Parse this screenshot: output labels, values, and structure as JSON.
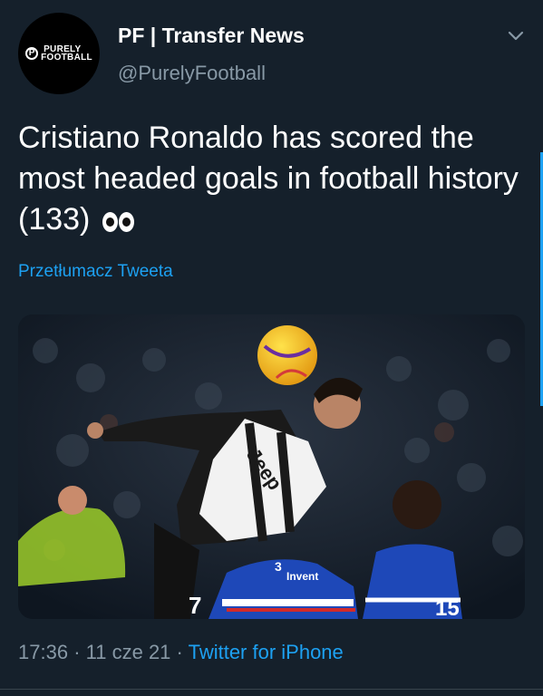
{
  "author": {
    "display_name": "PF | Transfer News",
    "handle": "@PurelyFootball",
    "avatar_logo_line1": "PURELY",
    "avatar_logo_line2": "FOOTBALL",
    "avatar_logo_mark": "P"
  },
  "tweet": {
    "text": "Cristiano Ronaldo has scored the most headed goals in football history (133)",
    "emoji_icon": "eyes-emoji-icon",
    "translate_label": "Przetłumacz Tweeta",
    "media_icon": "photo-image"
  },
  "photo_text": {
    "shirt_sponsor": "Jeep",
    "opponent_sponsor": "Invent",
    "number_left": "7",
    "number_mid": "3",
    "number_right": "15"
  },
  "meta": {
    "time": "17:36",
    "separator": "·",
    "date": "11 cze 21",
    "source": "Twitter for iPhone"
  },
  "colors": {
    "background": "#15202b",
    "accent": "#1da1f2",
    "secondary_text": "#8899a6"
  },
  "icons": {
    "more": "chevron-down-icon"
  }
}
